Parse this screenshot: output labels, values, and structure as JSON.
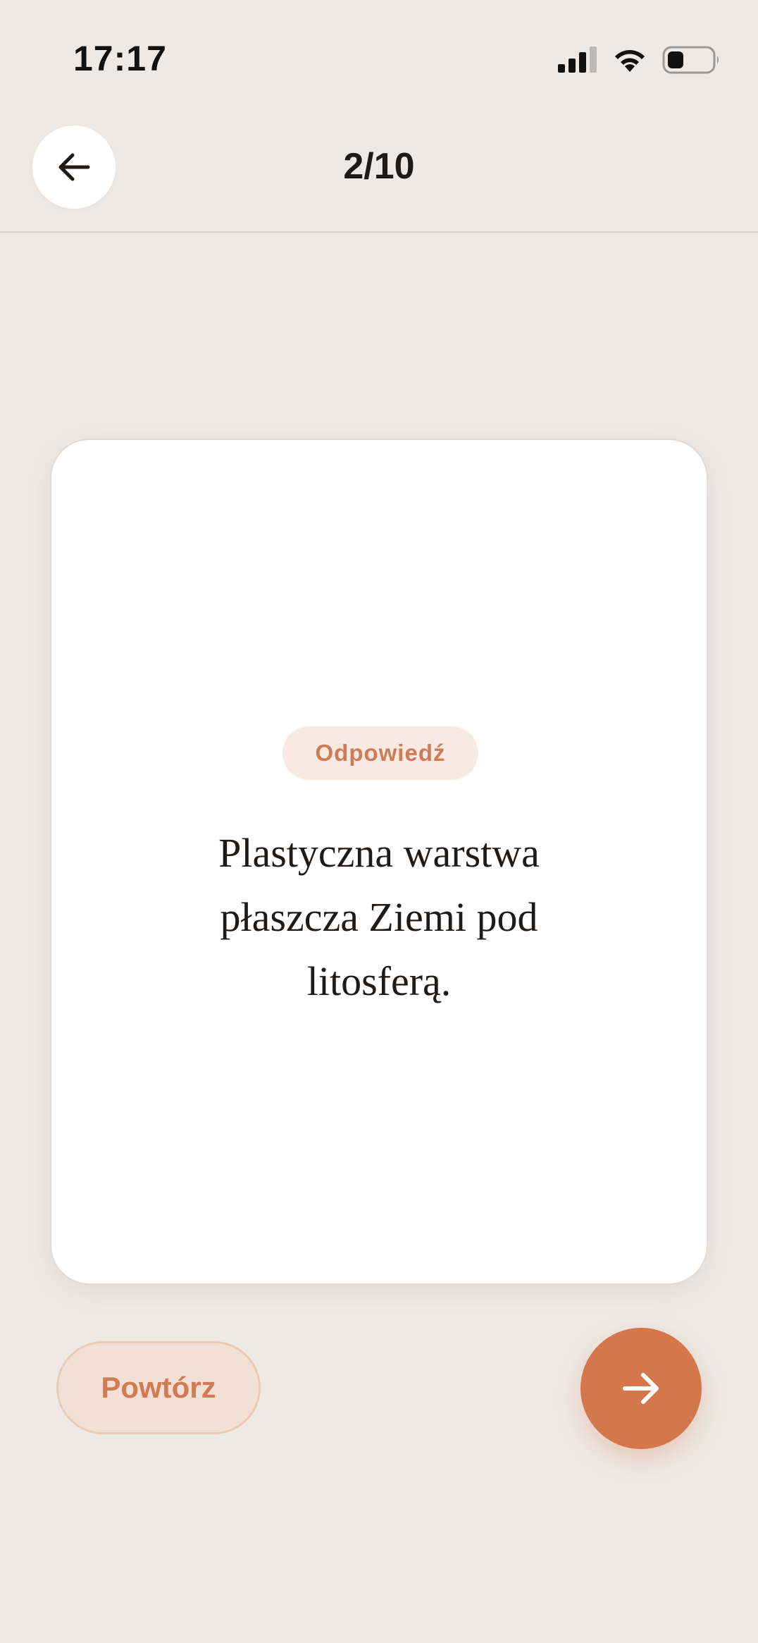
{
  "status_bar": {
    "time": "17:17",
    "icons": [
      "cellular-signal-icon",
      "wifi-icon",
      "battery-icon"
    ]
  },
  "header": {
    "back_icon": "arrow-left-icon",
    "progress": "2/10"
  },
  "card": {
    "badge": "Odpowiedź",
    "lines": [
      "Plastyczna warstwa",
      "płaszcza Ziemi pod",
      "litosferą."
    ]
  },
  "actions": {
    "repeat_label": "Powtórz",
    "next_icon": "arrow-right-icon"
  },
  "colors": {
    "background": "#EEE9E4",
    "card": "#FFFFFF",
    "accent": "#D5774C",
    "badge_bg": "#F8EAE3",
    "repeat_bg": "#F2E0D6"
  }
}
